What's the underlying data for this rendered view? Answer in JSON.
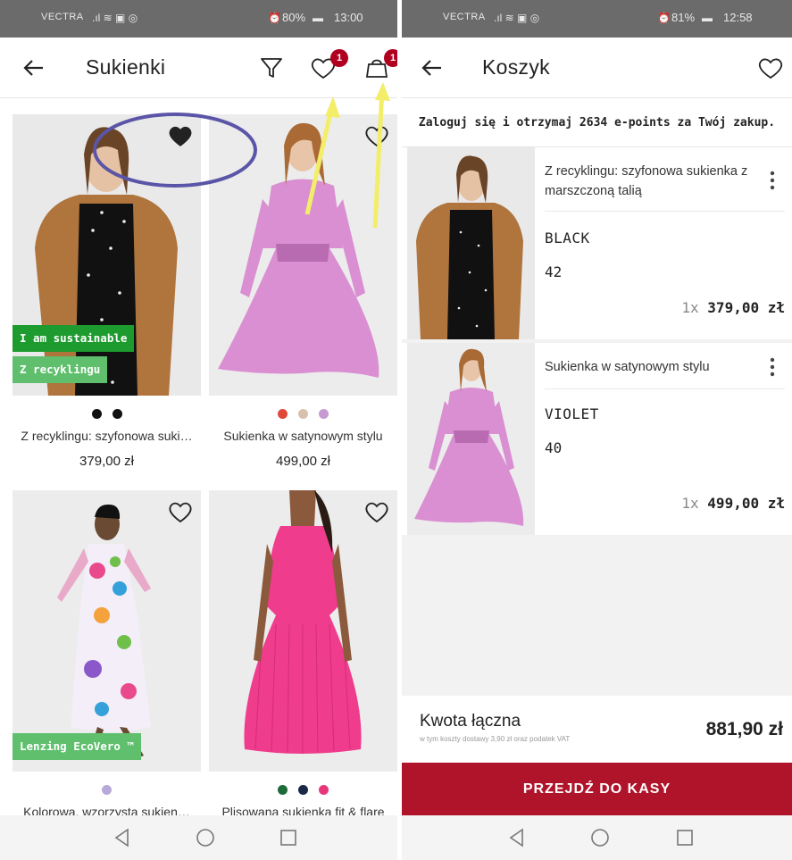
{
  "left": {
    "status": {
      "carrier": "VECTRA",
      "battery": "80%",
      "time": "13:00"
    },
    "title": "Sukienki",
    "wishlist_badge": "1",
    "bag_badge": "1",
    "products": [
      {
        "name": "Z recyklingu: szyfonowa suki…",
        "price": "379,00 zł",
        "tags": [
          "I am sustainable",
          "Z recyklingu"
        ],
        "swatches": [
          "#111111",
          "#111111"
        ],
        "favorited": true
      },
      {
        "name": "Sukienka w satynowym stylu",
        "price": "499,00 zł",
        "tags": [],
        "swatches": [
          "#e0493a",
          "#d9bfae",
          "#c79ad2"
        ],
        "favorited": false
      },
      {
        "name": "Kolorowa, wzorzysta sukien…",
        "price": "",
        "tags": [
          "Lenzing EcoVero ™"
        ],
        "swatches": [
          "#b8a9d9"
        ],
        "favorited": false
      },
      {
        "name": "Plisowana sukienka fit & flare",
        "price": "",
        "tags": [],
        "swatches": [
          "#1d6b3a",
          "#1a2746",
          "#e8367a"
        ],
        "favorited": false
      }
    ]
  },
  "right": {
    "status": {
      "carrier": "VECTRA",
      "battery": "81%",
      "time": "12:58"
    },
    "title": "Koszyk",
    "promo": "Zaloguj się i otrzymaj 2634 e-points za Twój zakup.",
    "items": [
      {
        "name": "Z recyklingu: szyfonowa sukienka z marszczoną talią",
        "color": "BLACK",
        "size": "42",
        "qty": "1x",
        "price": "379,00 zł"
      },
      {
        "name": "Sukienka w satynowym stylu",
        "color": "VIOLET",
        "size": "40",
        "qty": "1x",
        "price": "499,00 zł"
      }
    ],
    "total_label": "Kwota łączna",
    "total_sub": "w tym koszty dostawy 3,90 zł oraz podatek VAT",
    "total_amount": "881,90 zł",
    "checkout_label": "PRZEJDŹ DO KASY"
  },
  "colors": {
    "badge": "#b00020",
    "checkout": "#b0142b",
    "tag_green": "#1e9b2e",
    "tag_light_green": "#5fbf6d",
    "annotation_ellipse": "#5b55a8",
    "annotation_arrow": "#f3ee6a"
  },
  "icons": [
    "back-arrow-icon",
    "filter-icon",
    "heart-icon",
    "bag-icon",
    "kebab-icon",
    "nav-back-icon",
    "nav-home-icon",
    "nav-recents-icon"
  ]
}
